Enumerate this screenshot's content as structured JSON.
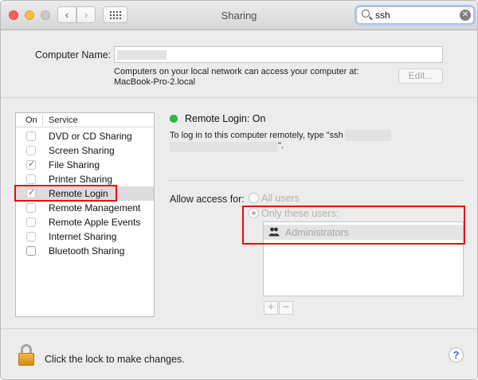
{
  "window": {
    "title": "Sharing",
    "search": {
      "value": "ssh",
      "clear_icon": "clear-icon"
    }
  },
  "computer_name": {
    "label": "Computer Name:",
    "value": "",
    "hint_line1": "Computers on your local network can access your computer at:",
    "hint_line2": "MacBook-Pro-2.local",
    "edit_label": "Edit..."
  },
  "services": {
    "header_on": "On",
    "header_service": "Service",
    "items": [
      {
        "label": "DVD or CD Sharing",
        "checked": false
      },
      {
        "label": "Screen Sharing",
        "checked": false
      },
      {
        "label": "File Sharing",
        "checked": true
      },
      {
        "label": "Printer Sharing",
        "checked": false
      },
      {
        "label": "Remote Login",
        "checked": true,
        "selected": true
      },
      {
        "label": "Remote Management",
        "checked": false
      },
      {
        "label": "Remote Apple Events",
        "checked": false
      },
      {
        "label": "Internet Sharing",
        "checked": false
      },
      {
        "label": "Bluetooth Sharing",
        "checked": false
      }
    ]
  },
  "detail": {
    "status": "Remote Login: On",
    "status_color": "#28c03f",
    "login_info_prefix": "To log in to this computer remotely, type \"ssh",
    "login_info_suffix": "\".",
    "allow_label": "Allow access for:",
    "option_all": "All users",
    "option_only": "Only these users:",
    "users": [
      "Administrators"
    ],
    "add_label": "+",
    "remove_label": "−"
  },
  "footer": {
    "lock_text": "Click the lock to make changes.",
    "help_label": "?"
  },
  "highlight_color": "#e60b0b"
}
